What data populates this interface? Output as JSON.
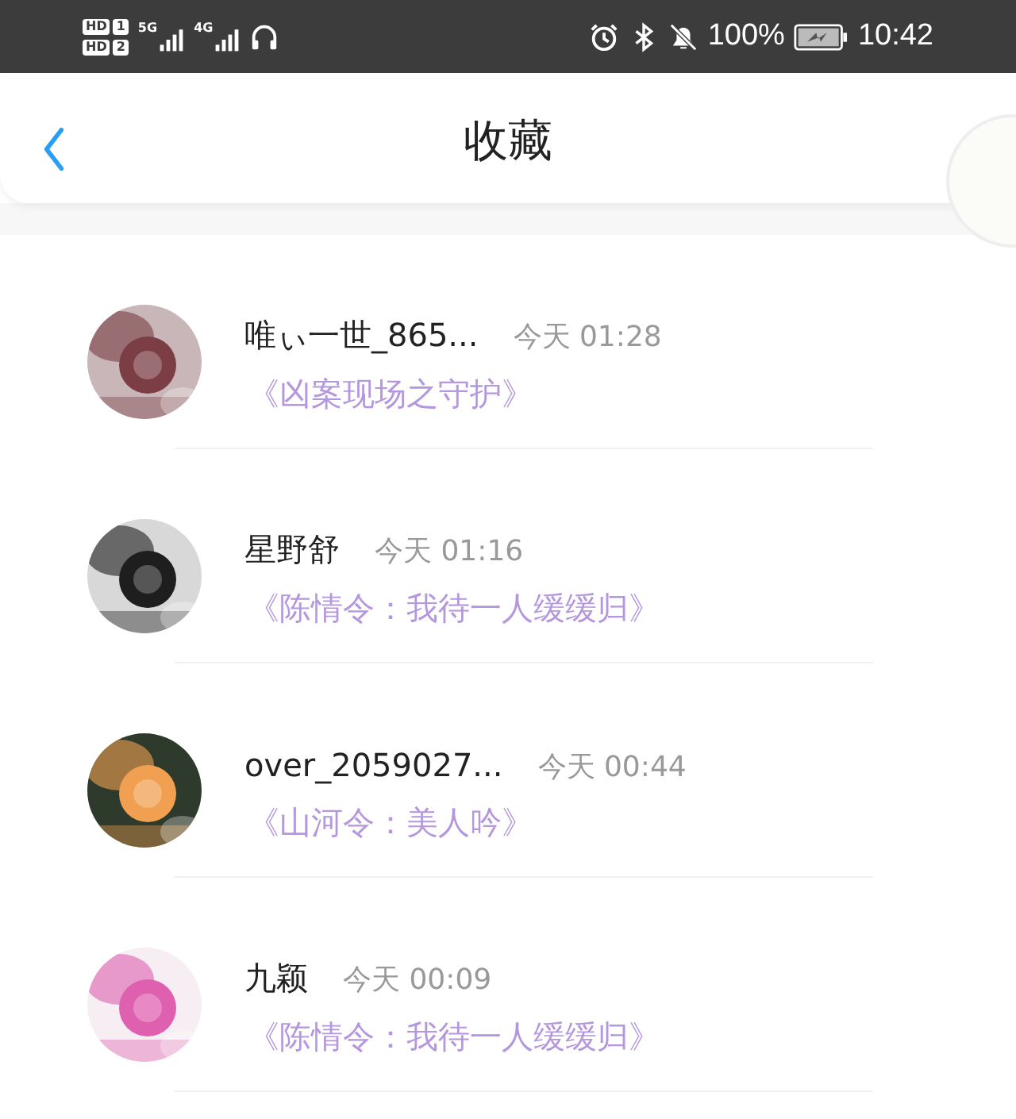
{
  "status_bar": {
    "sims": [
      {
        "badge": "HD",
        "slot": "1"
      },
      {
        "badge": "HD",
        "slot": "2"
      }
    ],
    "networks": [
      "5G",
      "4G"
    ],
    "battery": "100%",
    "time": "10:42"
  },
  "header": {
    "title": "收藏"
  },
  "favorites": [
    {
      "name": "唯ぃ一世_865...",
      "time": "今天 01:28",
      "work": "《凶案现场之守护》"
    },
    {
      "name": "星野舒",
      "time": "今天 01:16",
      "work": "《陈情令：我待一人缓缓归》"
    },
    {
      "name": "over_2059027...",
      "time": "今天 00:44",
      "work": "《山河令：美人吟》"
    },
    {
      "name": "九颖",
      "time": "今天 00:09",
      "work": "《陈情令：我待一人缓缓归》"
    }
  ]
}
